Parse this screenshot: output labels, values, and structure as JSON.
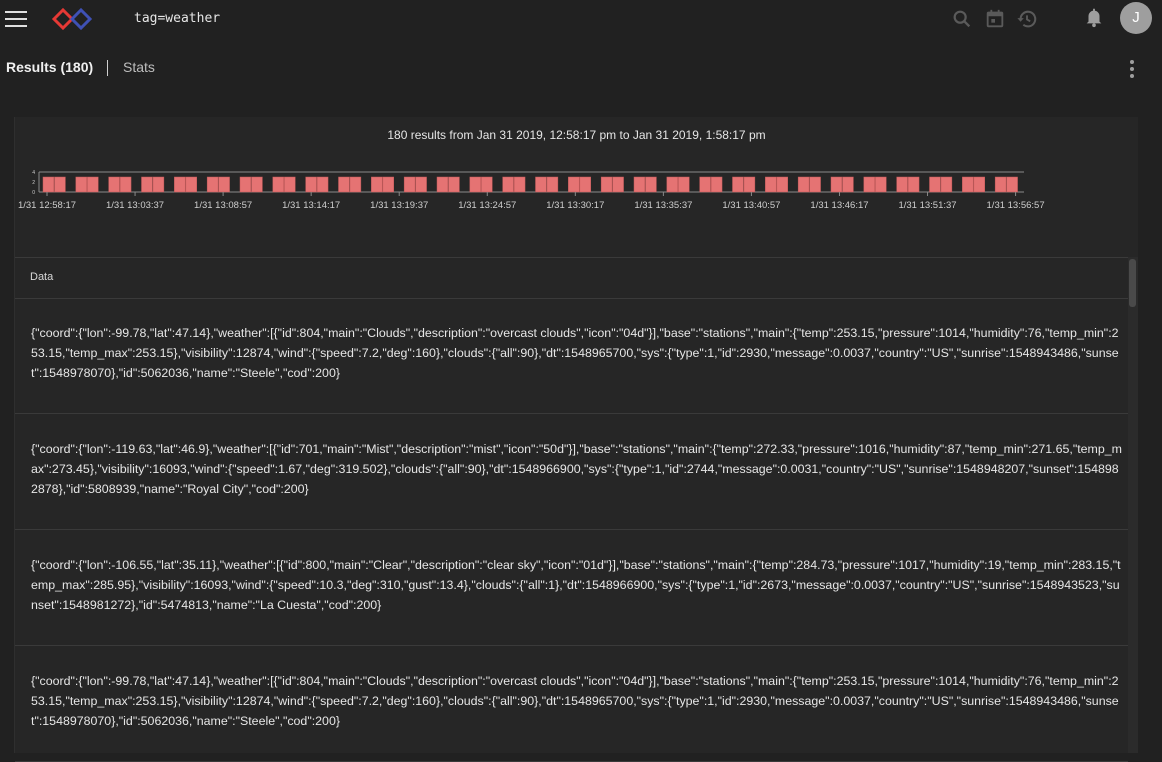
{
  "topbar": {
    "query": "tag=weather",
    "user_initial": "J",
    "icons": [
      "menu-icon",
      "app-logo",
      "search-icon",
      "calendar-icon",
      "history-icon",
      "bell-icon"
    ]
  },
  "tabs": [
    {
      "label": "Results (180)",
      "active": true
    },
    {
      "label": "Stats",
      "active": false
    }
  ],
  "summary": "180 results from Jan 31 2019, 12:58:17 pm to Jan 31 2019, 1:58:17 pm",
  "chart_data": {
    "type": "bar",
    "y_ticks": [
      "4",
      "2",
      "0"
    ],
    "ylim": [
      0,
      4
    ],
    "x_tick_labels": [
      "1/31 12:58:17",
      "1/31 13:03:37",
      "1/31 13:08:57",
      "1/31 13:14:17",
      "1/31 13:19:37",
      "1/31 13:24:57",
      "1/31 13:30:17",
      "1/31 13:35:37",
      "1/31 13:40:57",
      "1/31 13:46:17",
      "1/31 13:51:37",
      "1/31 13:56:57"
    ],
    "bar_groups": 30,
    "bars_per_group": 2,
    "bar_value": 3,
    "bar_color": "#e57373"
  },
  "table": {
    "header": "Data",
    "rows": [
      "{\"coord\":{\"lon\":-99.78,\"lat\":47.14},\"weather\":[{\"id\":804,\"main\":\"Clouds\",\"description\":\"overcast clouds\",\"icon\":\"04d\"}],\"base\":\"stations\",\"main\":{\"temp\":253.15,\"pressure\":1014,\"humidity\":76,\"temp_min\":253.15,\"temp_max\":253.15},\"visibility\":12874,\"wind\":{\"speed\":7.2,\"deg\":160},\"clouds\":{\"all\":90},\"dt\":1548965700,\"sys\":{\"type\":1,\"id\":2930,\"message\":0.0037,\"country\":\"US\",\"sunrise\":1548943486,\"sunset\":1548978070},\"id\":5062036,\"name\":\"Steele\",\"cod\":200}",
      "{\"coord\":{\"lon\":-119.63,\"lat\":46.9},\"weather\":[{\"id\":701,\"main\":\"Mist\",\"description\":\"mist\",\"icon\":\"50d\"}],\"base\":\"stations\",\"main\":{\"temp\":272.33,\"pressure\":1016,\"humidity\":87,\"temp_min\":271.65,\"temp_max\":273.45},\"visibility\":16093,\"wind\":{\"speed\":1.67,\"deg\":319.502},\"clouds\":{\"all\":90},\"dt\":1548966900,\"sys\":{\"type\":1,\"id\":2744,\"message\":0.0031,\"country\":\"US\",\"sunrise\":1548948207,\"sunset\":1548982878},\"id\":5808939,\"name\":\"Royal City\",\"cod\":200}",
      "{\"coord\":{\"lon\":-106.55,\"lat\":35.11},\"weather\":[{\"id\":800,\"main\":\"Clear\",\"description\":\"clear sky\",\"icon\":\"01d\"}],\"base\":\"stations\",\"main\":{\"temp\":284.73,\"pressure\":1017,\"humidity\":19,\"temp_min\":283.15,\"temp_max\":285.95},\"visibility\":16093,\"wind\":{\"speed\":10.3,\"deg\":310,\"gust\":13.4},\"clouds\":{\"all\":1},\"dt\":1548966900,\"sys\":{\"type\":1,\"id\":2673,\"message\":0.0037,\"country\":\"US\",\"sunrise\":1548943523,\"sunset\":1548981272},\"id\":5474813,\"name\":\"La Cuesta\",\"cod\":200}",
      "{\"coord\":{\"lon\":-99.78,\"lat\":47.14},\"weather\":[{\"id\":804,\"main\":\"Clouds\",\"description\":\"overcast clouds\",\"icon\":\"04d\"}],\"base\":\"stations\",\"main\":{\"temp\":253.15,\"pressure\":1014,\"humidity\":76,\"temp_min\":253.15,\"temp_max\":253.15},\"visibility\":12874,\"wind\":{\"speed\":7.2,\"deg\":160},\"clouds\":{\"all\":90},\"dt\":1548965700,\"sys\":{\"type\":1,\"id\":2930,\"message\":0.0037,\"country\":\"US\",\"sunrise\":1548943486,\"sunset\":1548978070},\"id\":5062036,\"name\":\"Steele\",\"cod\":200}"
    ]
  }
}
